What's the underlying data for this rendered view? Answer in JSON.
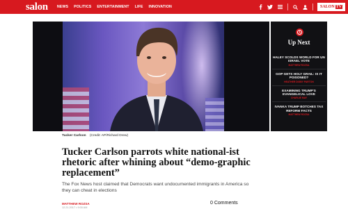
{
  "header": {
    "logo": "salon",
    "nav": [
      "NEWS",
      "POLITICS",
      "ENTERTAINMENT",
      "LIFE",
      "INNOVATION"
    ],
    "salon_tv": {
      "a": "SALON",
      "b": "TV"
    },
    "brand_color": "#d7191f"
  },
  "hero": {
    "image_alt": "Tucker Carlson",
    "caption_name": "Tucker Carlson",
    "caption_credit": "(Credit: AP/Richard Drew)"
  },
  "up_next": {
    "title": "Up Next",
    "items": [
      {
        "headline": "HALEY SCOLDS WORLD FOR UN ISRAEL VOTE",
        "author": "MATTHEW ROZSA"
      },
      {
        "headline": "GOP GETS HOLY GRAIL: IS IT POISONED?",
        "author": "HEATHER DIGBY PARTON"
      },
      {
        "headline": "EXAMINING TRUMP'S EVANGELICAL LOVE",
        "author": "CHARLIE MAY"
      },
      {
        "headline": "IVANKA TRUMP BOTCHES TAX REFORM FACTS",
        "author": "MATTHEW ROZSA"
      }
    ]
  },
  "article": {
    "headline": "Tucker Carlson parrots white national-ist rhetoric after whining about “demo-graphic replacement”",
    "dek": "The Fox News host claimed that Democrats want undocumented immigrants in America so they can cheat in elections",
    "author": "MATTHEW ROZSA",
    "date": "12.21.2017 • 9:00 AM",
    "comments": "0 Comments"
  }
}
